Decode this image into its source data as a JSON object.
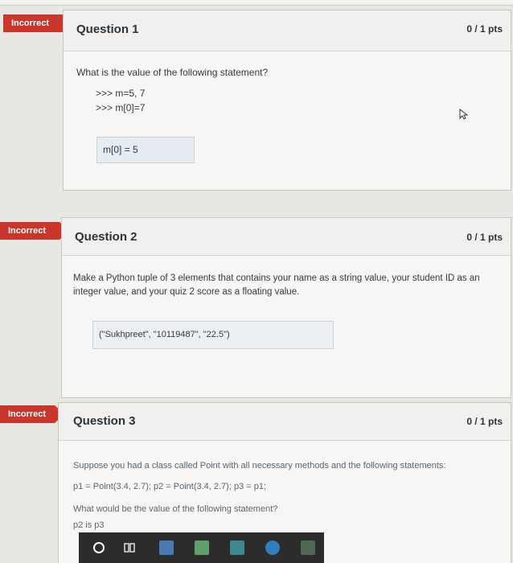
{
  "questions": [
    {
      "flag": "Incorrect",
      "title": "Question 1",
      "points": "0 / 1 pts",
      "prompt": "What is the value of the following statement?",
      "code": [
        ">>> m=5, 7",
        ">>> m[0]=7"
      ],
      "answer": "m[0] = 5"
    },
    {
      "flag": "Incorrect",
      "title": "Question 2",
      "points": "0 / 1 pts",
      "prompt": "Make a Python tuple of 3 elements that contains your name as a string value, your student ID as an integer value, and your quiz 2 score as a floating value.",
      "answer": "(\"Sukhpreet\", \"10119487\", \"22.5\")"
    },
    {
      "flag": "Incorrect",
      "title": "Question 3",
      "points": "0 / 1 pts",
      "prompt": "Suppose you had a class called Point with all necessary methods and the following statements:",
      "code_line": "p1 = Point(3.4, 2.7); p2 = Point(3.4, 2.7); p3 = p1;",
      "prompt2": "What would be the value of the following statement?",
      "code_partial": "p2 is p3"
    }
  ],
  "taskbar": {
    "icons": [
      "search-circle-icon",
      "task-view-icon",
      "store-icon",
      "files-icon",
      "mail-icon",
      "edge-browser-icon",
      "media-icon"
    ]
  }
}
